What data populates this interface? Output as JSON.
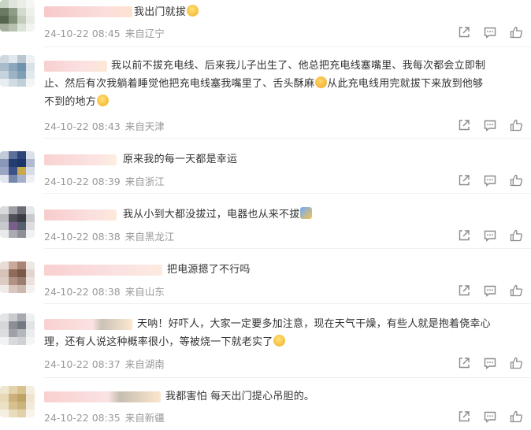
{
  "comments": [
    {
      "text_parts": [
        "我出门就拔"
      ],
      "emoji": "laugh",
      "date": "24-10-22 08:45",
      "location": "来自辽宁"
    },
    {
      "text_lines": [
        "我以前不拔充电线、后来我儿子出生了、他总把充电线塞嘴里、我每次都会立即制",
        "止、然后有次我躺着睡觉他把充电线塞我嘴里了、舌头酥麻",
        "从此充电线用完就拔下来放到他够",
        "不到的地方"
      ],
      "date": "24-10-22 08:43",
      "location": "来自天津"
    },
    {
      "text": "原来我的每一天都是幸运",
      "date": "24-10-22 08:39",
      "location": "来自浙江"
    },
    {
      "text": "我从小到大都没拔过，电器也从来不拔",
      "date": "24-10-22 08:38",
      "location": "来自黑龙江"
    },
    {
      "text": "把电源摁了不行吗",
      "date": "24-10-22 08:38",
      "location": "来自山东"
    },
    {
      "text_lines": [
        "天呐！好吓人，大家一定要多加注意，现在天气干燥，有些人就是抱着侥幸心",
        "理，还有人说这种概率很小，等被烧一下就老实了"
      ],
      "date": "24-10-22 08:37",
      "location": "来自湖南"
    },
    {
      "text": "我都害怕 每天出门提心吊胆的。",
      "date": "24-10-22 08:35",
      "location": "来自新疆"
    }
  ],
  "icons": {
    "share": "share-icon",
    "comment": "comment-icon",
    "like": "like-icon"
  },
  "colors": {
    "text": "#333333",
    "meta": "#999999",
    "icon": "#8a8a8a"
  }
}
